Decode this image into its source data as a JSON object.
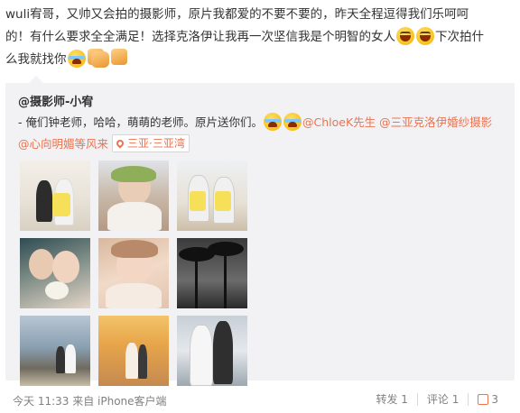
{
  "post": {
    "line1": "wuli宥哥，又帅又会拍的摄影师，原片我都爱的不要不要的，昨天全程逗得我们乐呵呵",
    "line2_a": "的！有什么要求全全满足！选择克洛伊让我再一次坚信我是个明智的女人",
    "line2_b": "下次拍什",
    "line3": "么我就找你"
  },
  "repost": {
    "author": "@摄影师-小宥",
    "text": "- 俺们钟老师，哈哈，萌萌的老师。原片送你们。",
    "mentions": [
      "@ChloeK先生",
      "@三亚克洛伊婚纱摄影",
      "@心向明媚等风来"
    ],
    "location": "三亚·三亚湾"
  },
  "footer": {
    "meta": "今天 11:33 来自 iPhone客户端",
    "forward": "转发 1",
    "comment": "评论 1",
    "likes": "3"
  }
}
